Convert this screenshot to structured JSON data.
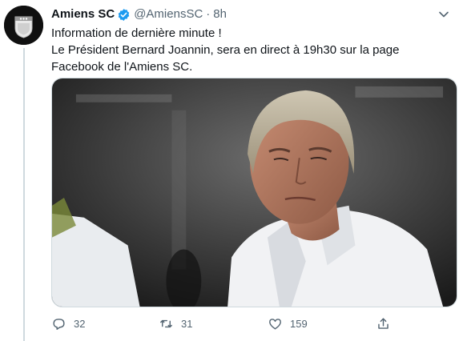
{
  "tweet": {
    "display_name": "Amiens SC",
    "handle": "@AmiensSC",
    "separator": "·",
    "time": "8h",
    "verified": true,
    "lines": [
      "Information de dernière minute !",
      "Le Président Bernard Joannin, sera en direct à 19h30 sur la page",
      "Facebook de l'Amiens SC."
    ]
  },
  "actions": {
    "reply_count": "32",
    "retweet_count": "31",
    "like_count": "159"
  },
  "colors": {
    "verified": "#1d9bf0",
    "secondary_text": "#536471",
    "divider": "#cfd9de"
  },
  "icons": {
    "reply": "reply-icon",
    "retweet": "retweet-icon",
    "like": "heart-icon",
    "share": "share-icon",
    "more": "chevron-down-icon"
  }
}
